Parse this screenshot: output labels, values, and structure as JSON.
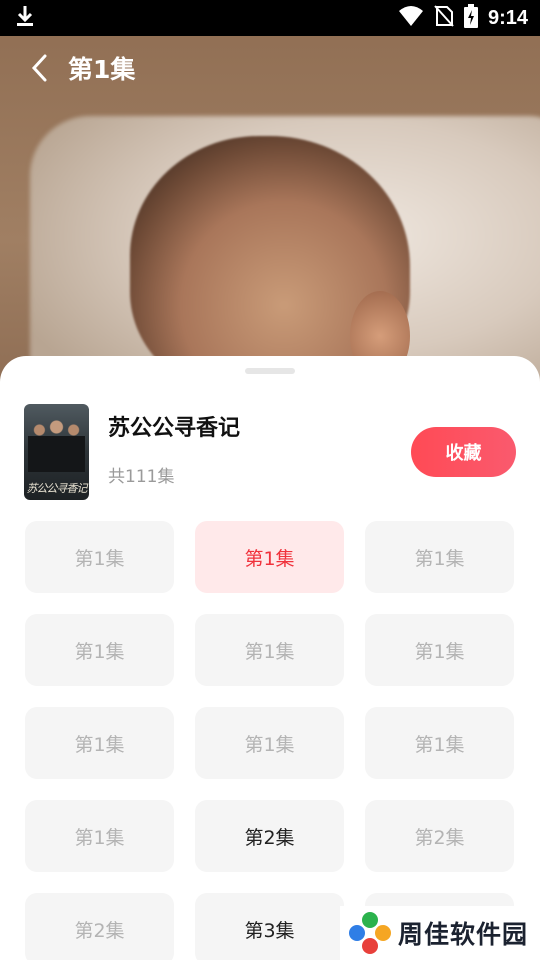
{
  "status_bar": {
    "time": "9:14",
    "icons": [
      "download-icon",
      "wifi-icon",
      "no-sim-icon",
      "battery-charging-icon"
    ]
  },
  "nav": {
    "back_icon": "chevron-left-icon",
    "title": "第1集"
  },
  "drama": {
    "title": "苏公公寻香记",
    "episode_count": "共111集",
    "poster_text": "苏公公寻香记",
    "favorite_label": "收藏"
  },
  "episodes": [
    {
      "label": "第1集",
      "state": "normal"
    },
    {
      "label": "第1集",
      "state": "active"
    },
    {
      "label": "第1集",
      "state": "normal"
    },
    {
      "label": "第1集",
      "state": "normal"
    },
    {
      "label": "第1集",
      "state": "normal"
    },
    {
      "label": "第1集",
      "state": "normal"
    },
    {
      "label": "第1集",
      "state": "normal"
    },
    {
      "label": "第1集",
      "state": "normal"
    },
    {
      "label": "第1集",
      "state": "normal"
    },
    {
      "label": "第1集",
      "state": "normal"
    },
    {
      "label": "第2集",
      "state": "dark"
    },
    {
      "label": "第2集",
      "state": "normal"
    },
    {
      "label": "第2集",
      "state": "normal"
    },
    {
      "label": "第3集",
      "state": "dark"
    },
    {
      "label": "",
      "state": "normal"
    }
  ],
  "watermark": {
    "text": "周佳软件园",
    "logo_colors": [
      "#2bb24c",
      "#f5a623",
      "#e8403b",
      "#2f7ee6"
    ]
  },
  "colors": {
    "accent": "#f0323c",
    "favorite_gradient_start": "#ff4a55",
    "favorite_gradient_end": "#fa5a6e",
    "tile_bg": "#f5f5f5",
    "tile_active_bg": "#ffe9ea"
  }
}
